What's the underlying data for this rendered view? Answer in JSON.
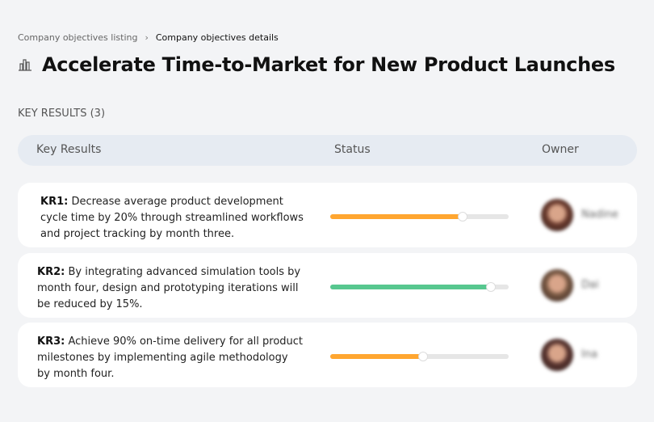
{
  "breadcrumb": {
    "parent": "Company objectives listing",
    "separator": "›",
    "current": "Company objectives details"
  },
  "title": {
    "icon": "building-chart-icon",
    "text": "Accelerate Time-to-Market for New Product Launches"
  },
  "section_label": "KEY RESULTS (3)",
  "table": {
    "headers": {
      "key_results": "Key Results",
      "status": "Status",
      "owner": "Owner"
    },
    "rows": [
      {
        "id": "KR1:",
        "text": "Decrease average product development cycle time by 20% through streamlined workflows and project tracking by month three.",
        "progress_percent": 74,
        "color": "#ffa630",
        "owner": "Nadine",
        "avatar_color": "#6b3b2e"
      },
      {
        "id": "KR2:",
        "text": "By integrating advanced simulation tools by month four, design and prototyping iterations will be reduced by 15%.",
        "progress_percent": 90,
        "color": "#57c78f",
        "owner": "Dai",
        "avatar_color": "#7a5a44"
      },
      {
        "id": "KR3:",
        "text": "Achieve 90% on-time delivery for all product milestones by implementing agile methodology by month four.",
        "progress_percent": 52,
        "color": "#ffa630",
        "owner": "Ina",
        "avatar_color": "#5a3530"
      }
    ]
  }
}
